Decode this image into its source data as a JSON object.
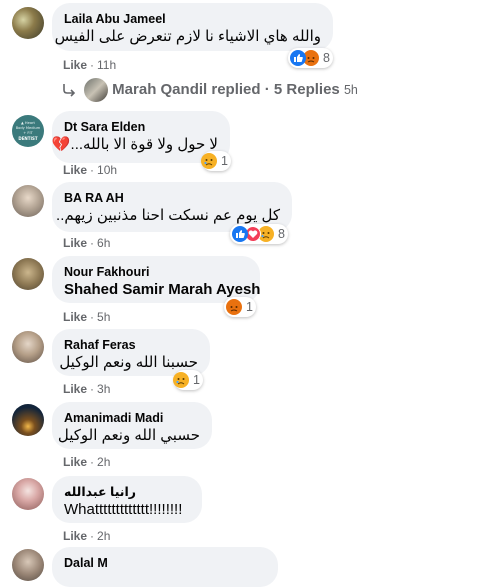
{
  "comments": [
    {
      "name": "Laila Abu Jameel",
      "text": "والله هاي الاشياء نا لازم تنعرض على الفيس",
      "like": "Like",
      "time": "11h",
      "reactions": "8"
    },
    {
      "name": "Dt Sara Elden",
      "text": "لا حول ولا قوة الا بالله...💔",
      "like": "Like",
      "time": "10h",
      "reactions": "1"
    },
    {
      "name": "BA RA AH",
      "text": "كل يوم عم نسكت احنا مذنبين زيهم..",
      "like": "Like",
      "time": "6h",
      "reactions": "8"
    },
    {
      "name": "Nour Fakhouri",
      "text": "Shahed Samir Marah Ayesh",
      "like": "Like",
      "time": "5h",
      "reactions": "1"
    },
    {
      "name": "Rahaf Feras",
      "text": "حسبنا الله ونعم الوكيل",
      "like": "Like",
      "time": "3h",
      "reactions": "1"
    },
    {
      "name": "Amanimadi Madi",
      "text": "حسبي الله ونعم الوكيل",
      "like": "Like",
      "time": "2h",
      "reactions": ""
    },
    {
      "name": "رانيا عبدالله",
      "text": "Whattttttttttttt!!!!!!!!",
      "like": "Like",
      "time": "2h",
      "reactions": ""
    },
    {
      "name": "Dalal M",
      "text": "",
      "like": "",
      "time": "",
      "reactions": ""
    }
  ],
  "replies": {
    "author": "Marah Qandil replied",
    "sep": "·",
    "count": "5 Replies",
    "time": "5h"
  },
  "avatar_text": {
    "sara": [
      "▲ Heart",
      "Body Medium",
      "+ FIT",
      "DENTIST"
    ]
  },
  "icons": {
    "like": "like-reaction-icon",
    "love": "love-reaction-icon",
    "sad": "sad-reaction-icon",
    "angry": "angry-reaction-icon"
  },
  "colors": {
    "like": "#1877f2",
    "love": "#f33e58",
    "sad": "#f7b125",
    "angry": "#e9710f",
    "bubble": "#f0f2f5",
    "meta": "#65676b"
  }
}
